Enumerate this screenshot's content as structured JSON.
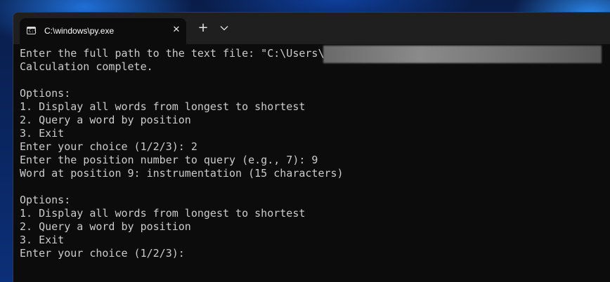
{
  "window": {
    "tab_title": "C:\\windows\\py.exe",
    "tab_icon_text": "C:\\",
    "close_glyph": "✕",
    "new_tab_glyph": "+"
  },
  "terminal": {
    "lines": [
      "Enter the full path to the text file: \"C:\\Users\\",
      "Calculation complete.",
      "",
      "Options:",
      "1. Display all words from longest to shortest",
      "2. Query a word by position",
      "3. Exit",
      "Enter your choice (1/2/3): 2",
      "Enter the position number to query (e.g., 7): 9",
      "Word at position 9: instrumentation (15 characters)",
      "",
      "Options:",
      "1. Display all words from longest to shortest",
      "2. Query a word by position",
      "3. Exit",
      "Enter your choice (1/2/3):"
    ]
  },
  "colors": {
    "terminal_bg": "#0c0c0c",
    "titlebar_bg": "#1f1f1f",
    "text": "#cccccc"
  }
}
